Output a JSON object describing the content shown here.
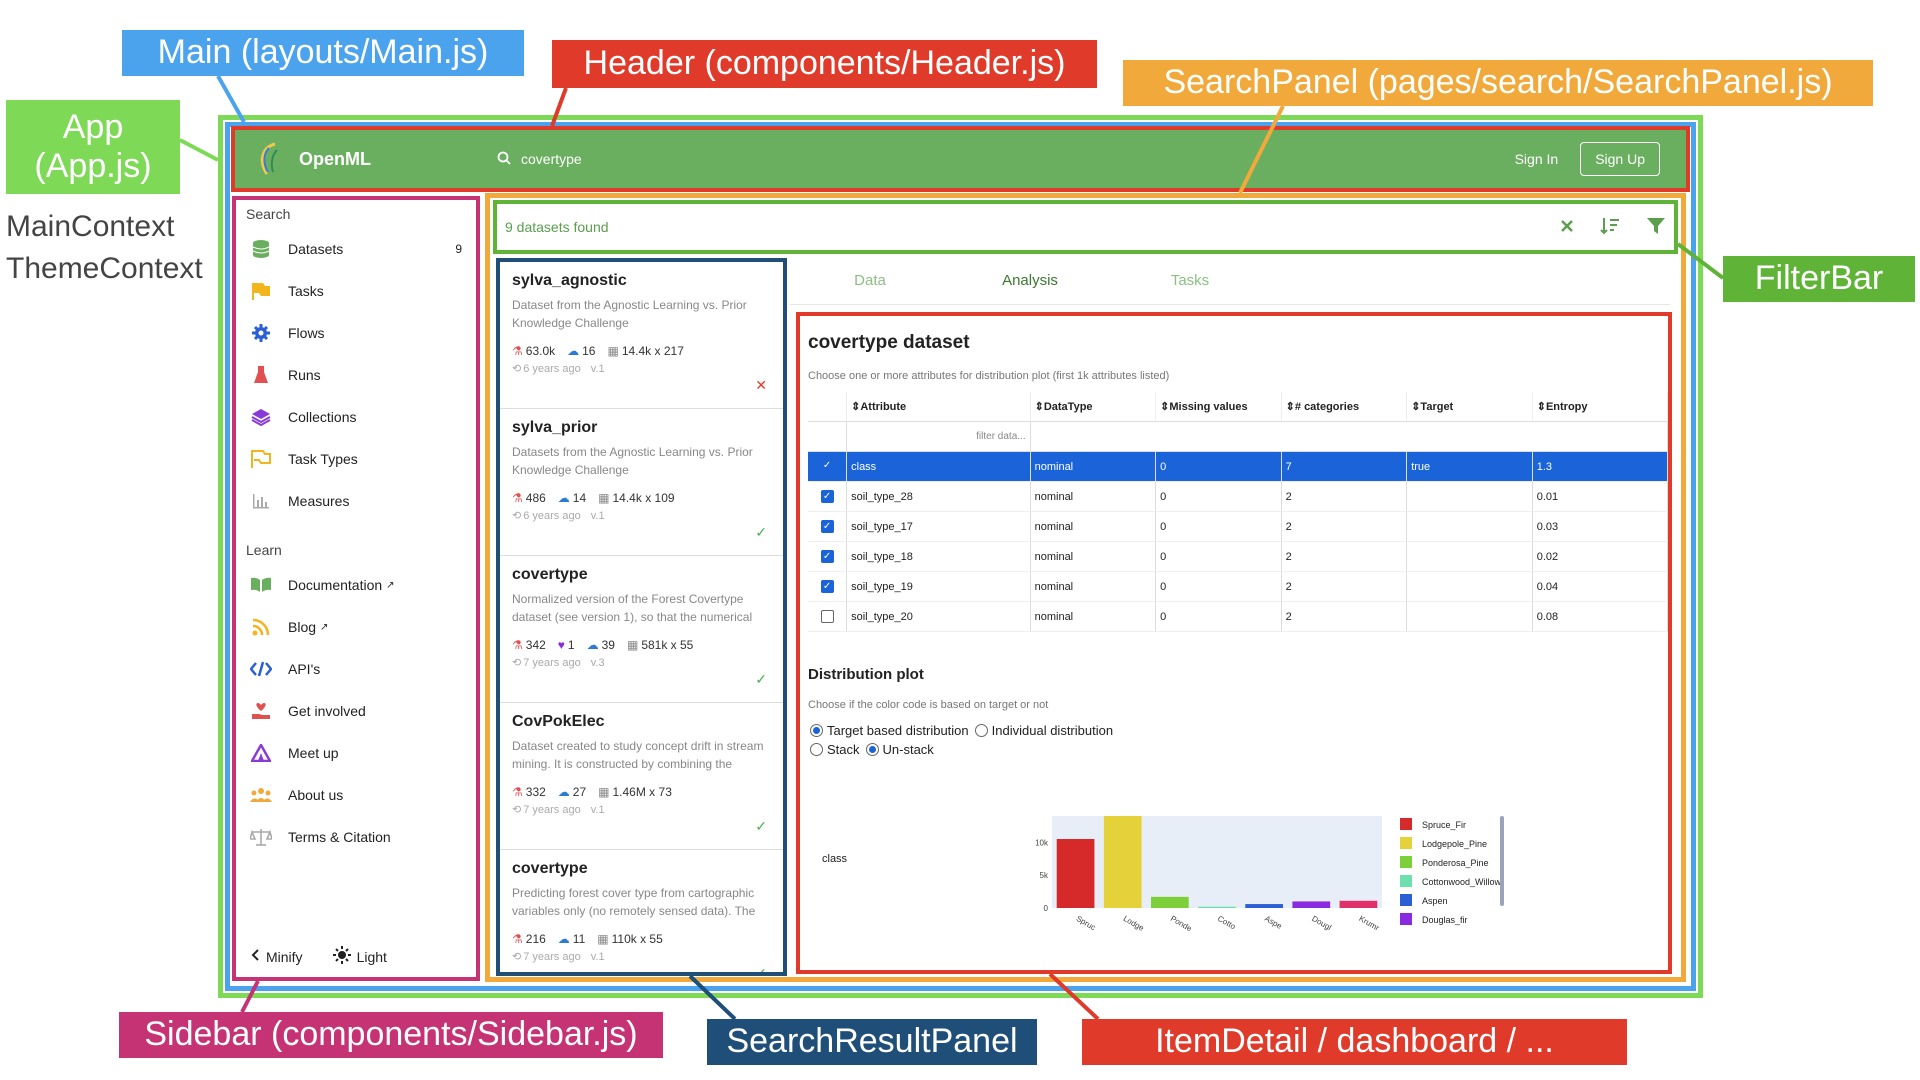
{
  "callouts": {
    "main": "Main (layouts/Main.js)",
    "header": "Header (components/Header.js)",
    "searchpanel": "SearchPanel (pages/search/SearchPanel.js)",
    "app": "App\n(App.js)",
    "filterbar": "FilterBar",
    "sidebar": "Sidebar (components/Sidebar.js)",
    "searchresultpanel": "SearchResultPanel",
    "itemdetail": "ItemDetail / dashboard / ..."
  },
  "contexts": [
    "MainContext",
    "ThemeContext"
  ],
  "colors": {
    "app": "#7ed957",
    "main": "#4ba3ee",
    "header": "#e03a2a",
    "searchpanel": "#f2a93b",
    "filterbar": "#5fb337",
    "sidebar": "#c63375",
    "searchresultpanel": "#1f4e79",
    "itemdetail": "#e03a2a"
  },
  "header": {
    "brand": "OpenML",
    "search_value": "covertype",
    "sign_in": "Sign In",
    "sign_up": "Sign Up"
  },
  "sidebar": {
    "search_title": "Search",
    "search_items": [
      {
        "label": "Datasets",
        "icon": "database-icon",
        "count": "9"
      },
      {
        "label": "Tasks",
        "icon": "flag-icon"
      },
      {
        "label": "Flows",
        "icon": "gear-icon"
      },
      {
        "label": "Runs",
        "icon": "flask-icon"
      },
      {
        "label": "Collections",
        "icon": "layers-icon"
      },
      {
        "label": "Task Types",
        "icon": "flag-outline-icon"
      },
      {
        "label": "Measures",
        "icon": "bar-chart-icon"
      }
    ],
    "learn_title": "Learn",
    "learn_items": [
      {
        "label": "Documentation",
        "icon": "book-icon"
      },
      {
        "label": "Blog",
        "icon": "rss-icon"
      },
      {
        "label": "API's",
        "icon": "code-icon"
      },
      {
        "label": "Get involved",
        "icon": "hand-heart-icon"
      },
      {
        "label": "Meet up",
        "icon": "tent-icon"
      },
      {
        "label": "About us",
        "icon": "people-icon"
      },
      {
        "label": "Terms & Citation",
        "icon": "balance-icon"
      }
    ],
    "minify": "Minify",
    "light": "Light"
  },
  "filterbar": {
    "status": "9 datasets found"
  },
  "results": [
    {
      "title": "sylva_agnostic",
      "desc": "Dataset from the Agnostic Learning vs. Prior Knowledge Challenge",
      "runs": "63.0k",
      "likes": "",
      "downloads": "16",
      "size": "14.4k x 217",
      "age": "6 years ago",
      "version": "v.1",
      "status": "✕",
      "status_color": "#e03a2a"
    },
    {
      "title": "sylva_prior",
      "desc": "Datasets from the Agnostic Learning vs. Prior Knowledge Challenge",
      "runs": "486",
      "likes": "",
      "downloads": "14",
      "size": "14.4k x 109",
      "age": "6 years ago",
      "version": "v.1",
      "status": "✓",
      "status_color": "#4caf50"
    },
    {
      "title": "covertype",
      "desc": "Normalized version of the Forest Covertype dataset (see version 1), so that the numerical",
      "runs": "342",
      "likes": "1",
      "downloads": "39",
      "size": "581k x 55",
      "age": "7 years ago",
      "version": "v.3",
      "status": "✓",
      "status_color": "#4caf50"
    },
    {
      "title": "CovPokElec",
      "desc": "Dataset created to study concept drift in stream mining. It is constructed by combining the",
      "runs": "332",
      "likes": "",
      "downloads": "27",
      "size": "1.46M x 73",
      "age": "7 years ago",
      "version": "v.1",
      "status": "✓",
      "status_color": "#4caf50"
    },
    {
      "title": "covertype",
      "desc": "Predicting forest cover type from cartographic variables only (no remotely sensed data). The",
      "runs": "216",
      "likes": "",
      "downloads": "11",
      "size": "110k x 55",
      "age": "7 years ago",
      "version": "v.1",
      "status": "✓",
      "status_color": "#4caf50"
    }
  ],
  "detail": {
    "tabs": [
      "Data",
      "Analysis",
      "Tasks"
    ],
    "title": "covertype dataset",
    "subtitle": "Choose one or more attributes for distribution plot (first 1k attributes listed)",
    "columns": [
      "⇕Attribute",
      "⇕DataType",
      "⇕Missing values",
      "⇕# categories",
      "⇕Target",
      "⇕Entropy"
    ],
    "filter_placeholder": "filter data...",
    "rows": [
      {
        "checked": true,
        "selected": true,
        "cells": [
          "class",
          "nominal",
          "0",
          "7",
          "true",
          "1.3"
        ]
      },
      {
        "checked": true,
        "selected": false,
        "cells": [
          "soil_type_28",
          "nominal",
          "0",
          "2",
          "",
          "0.01"
        ]
      },
      {
        "checked": true,
        "selected": false,
        "cells": [
          "soil_type_17",
          "nominal",
          "0",
          "2",
          "",
          "0.03"
        ]
      },
      {
        "checked": true,
        "selected": false,
        "cells": [
          "soil_type_18",
          "nominal",
          "0",
          "2",
          "",
          "0.02"
        ]
      },
      {
        "checked": true,
        "selected": false,
        "cells": [
          "soil_type_19",
          "nominal",
          "0",
          "2",
          "",
          "0.04"
        ]
      },
      {
        "checked": false,
        "selected": false,
        "cells": [
          "soil_type_20",
          "nominal",
          "0",
          "2",
          "",
          "0.08"
        ]
      }
    ],
    "dist_title": "Distribution plot",
    "dist_subtitle": "Choose if the color code is based on target or not",
    "radios": [
      {
        "label": "Target based distribution",
        "on": true
      },
      {
        "label": "Individual distribution",
        "on": false
      },
      {
        "label": "Stack",
        "on": false
      },
      {
        "label": "Un-stack",
        "on": true
      }
    ]
  },
  "chart_data": {
    "type": "bar",
    "row_label": "class",
    "categories": [
      "Spruce_Fir",
      "Lodgepole_Pine",
      "Ponderosa_Pine",
      "Cottonwood_Willow",
      "Aspen",
      "Douglas_fir",
      "Krummholz"
    ],
    "tick_labels": [
      "Spruc",
      "Lodge",
      "Ponde",
      "Cotto",
      "Aspe",
      "Dougl",
      "Krumr"
    ],
    "values": [
      10500,
      14000,
      1700,
      200,
      600,
      1000,
      1100
    ],
    "colors": [
      "#d62a2a",
      "#e5d23a",
      "#7ed03a",
      "#6ee0b0",
      "#2a5fd6",
      "#8a2ae0",
      "#e0306a"
    ],
    "yticks": [
      {
        "value": 0,
        "label": "0"
      },
      {
        "value": 5000,
        "label": "5k"
      },
      {
        "value": 10000,
        "label": "10k"
      }
    ],
    "ylim": [
      0,
      14000
    ],
    "legend": [
      "Spruce_Fir",
      "Lodgepole_Pine",
      "Ponderosa_Pine",
      "Cottonwood_Willow",
      "Aspen",
      "Douglas_fir"
    ],
    "legend_placement": "right",
    "grid": false
  }
}
